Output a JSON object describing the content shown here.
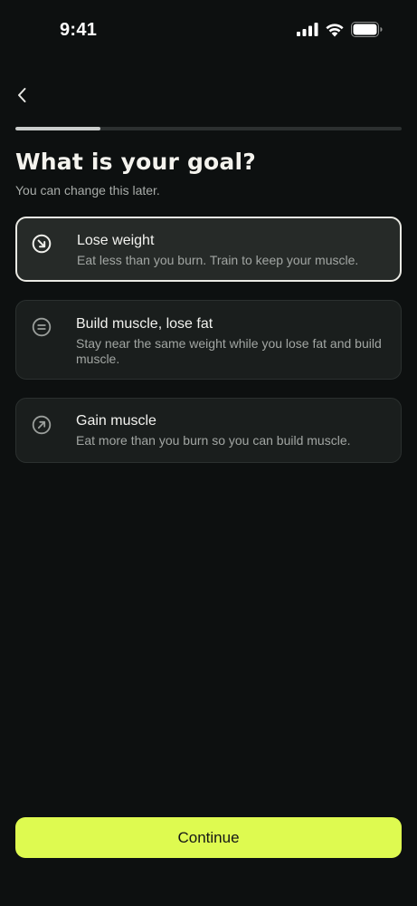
{
  "status_bar": {
    "time": "9:41",
    "icons": [
      "cellular-signal-icon",
      "wifi-icon",
      "battery-icon"
    ]
  },
  "nav": {
    "back_icon": "chevron-left-icon"
  },
  "progress": {
    "fraction": 0.22
  },
  "header": {
    "title": "What is your goal?",
    "subtitle": "You can change this later."
  },
  "options": [
    {
      "id": "lose-weight",
      "title": "Lose weight",
      "description": "Eat less than you burn. Train to keep your muscle.",
      "icon": "arrow-down-right-circle-icon",
      "selected": true
    },
    {
      "id": "build-muscle-lose-fat",
      "title": "Build muscle, lose fat",
      "description": "Stay near the same weight while you lose fat and build muscle.",
      "icon": "equals-circle-icon",
      "selected": false
    },
    {
      "id": "gain-muscle",
      "title": "Gain muscle",
      "description": "Eat more than you burn so you can build muscle.",
      "icon": "arrow-up-right-circle-icon",
      "selected": false
    }
  ],
  "footer": {
    "continue_label": "Continue"
  },
  "colors": {
    "background": "#0d1010",
    "card": "#1a1e1d",
    "selected_border": "#eaeae4",
    "accent": "#defa50"
  }
}
